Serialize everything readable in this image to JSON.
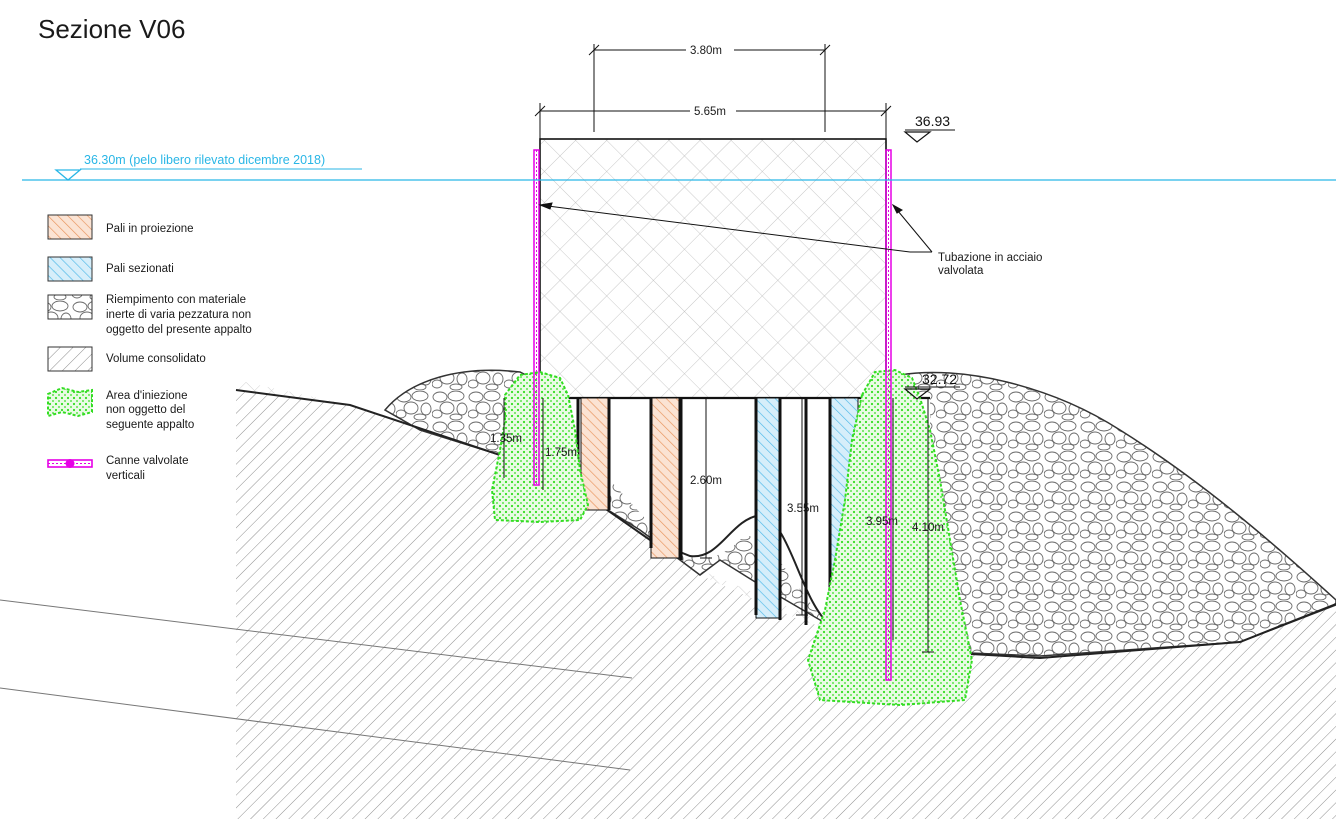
{
  "title": "Sezione V06",
  "water_level": {
    "label": "36.30m (pelo libero rilevato dicembre 2018)",
    "color": "#29b6e6"
  },
  "elevations": {
    "top": "36.93",
    "base": "32.72"
  },
  "dimensions": {
    "top_inner_width": "3.80m",
    "top_outer_width": "5.65m",
    "d_1_35": "1.35m",
    "d_1_75": "1.75m",
    "d_2_60": "2.60m",
    "d_3_55": "3.55m",
    "d_3_95": "3.95m",
    "d_4_10": "4.10m"
  },
  "annotation": {
    "line1": "Tubazione in acciaio",
    "line2": "valvolata"
  },
  "legend": {
    "projection_piles": "Pali in proiezione",
    "sectioned_piles": "Pali sezionati",
    "fill_line1": "Riempimento con materiale",
    "fill_line2": "inerte di varia pezzatura non",
    "fill_line3": "oggetto del presente appalto",
    "consolidated": "Volume consolidato",
    "injection_line1": "Area d'iniezione",
    "injection_line2": "non oggetto del",
    "injection_line3": "seguente appalto",
    "tubes_line1": "Canne valvolate",
    "tubes_line2": "verticali"
  },
  "colors": {
    "projection_piles": "#e8925a",
    "sectioned_piles": "#4db8e8",
    "injection_area": "#33dd22",
    "tubes": "#e600e6",
    "water": "#29b6e6"
  },
  "icons": {
    "water_marker": "triangle-down-icon",
    "level_marker": "triangle-down-icon",
    "tube_symbol": "valve-tube-icon"
  }
}
